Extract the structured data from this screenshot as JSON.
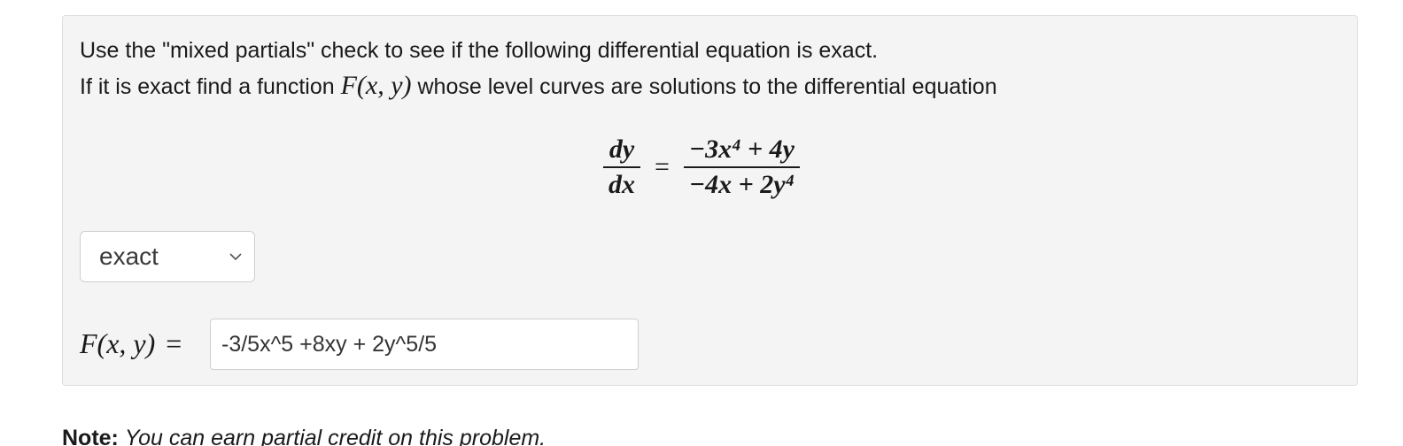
{
  "problem": {
    "line1": "Use the \"mixed partials\" check to see if the following differential equation is exact.",
    "line2_prefix": "If it is exact find a function",
    "line2_func": "F(x, y)",
    "line2_suffix": "whose level curves are solutions to the differential equation"
  },
  "equation": {
    "lhs_num": "dy",
    "lhs_den": "dx",
    "equals": "=",
    "rhs_num": "−3x⁴ + 4y",
    "rhs_den": "−4x + 2y⁴"
  },
  "exactness_select": {
    "selected": "exact",
    "icon": "chevron-down-icon"
  },
  "answer": {
    "label": "F(x, y)",
    "equals": "=",
    "value": "-3/5x^5 +8xy + 2y^5/5"
  },
  "note": {
    "strong": "Note:",
    "text": "You can earn partial credit on this problem."
  }
}
